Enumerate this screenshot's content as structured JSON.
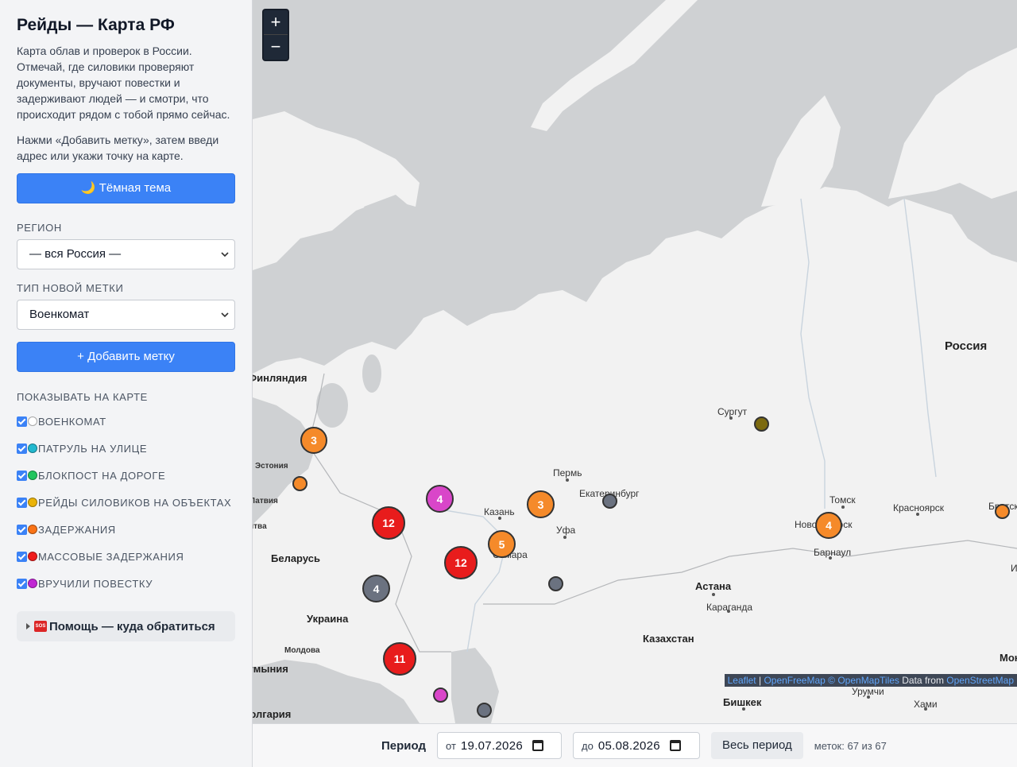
{
  "sidebar": {
    "title": "Рейды — Карта РФ",
    "intro": "Карта облав и проверок в России. Отмечай, где силовики проверяют документы, вручают повестки и задерживают людей — и смотри, что происходит рядом с тобой прямо сейчас.",
    "hint": "Нажми «Добавить метку», затем введи адрес или укажи точку на карте.",
    "theme_button": "🌙 Тёмная тема",
    "region_label": "РЕГИОН",
    "region_value": "— вся Россия —",
    "type_label": "ТИП НОВОЙ МЕТКИ",
    "type_value": "Военкомат",
    "add_button": "+ Добавить метку",
    "layers_label": "ПОКАЗЫВАТЬ НА КАРТЕ",
    "layers": [
      {
        "label": "ВОЕНКОМАТ",
        "color": "#ffffff",
        "checked": true
      },
      {
        "label": "ПАТРУЛЬ НА УЛИЦЕ",
        "color": "#22b8cf",
        "checked": true
      },
      {
        "label": "БЛОКПОСТ НА ДОРОГЕ",
        "color": "#22c55e",
        "checked": true
      },
      {
        "label": "РЕЙДЫ СИЛОВИКОВ НА ОБЪЕКТАХ",
        "color": "#eab308",
        "checked": true
      },
      {
        "label": "ЗАДЕРЖАНИЯ",
        "color": "#f97316",
        "checked": true
      },
      {
        "label": "МАССОВЫЕ ЗАДЕРЖАНИЯ",
        "color": "#ef1c1c",
        "checked": true
      },
      {
        "label": "ВРУЧИЛИ ПОВЕСТКУ",
        "color": "#c026d3",
        "checked": true
      }
    ],
    "help": "Помощь — куда обратиться"
  },
  "map": {
    "zoom_in": "+",
    "zoom_out": "−",
    "places": {
      "finland": "Финляндия",
      "estonia": "Эстония",
      "latvia": "Латвия",
      "lithuania": "Литва",
      "belarus": "Беларусь",
      "ukraine": "Украина",
      "moldova": "Молдова",
      "romania": "Румыния",
      "bulgaria": "Болгария",
      "russia": "Россия",
      "kazakhstan": "Казахстан",
      "astana": "Астана",
      "karaganda": "Караганда",
      "bishkek": "Бишкек",
      "urumqi": "Урумчи",
      "hami": "Хами",
      "perm": "Пермь",
      "yekaterinburg": "Екатеринбург",
      "kazan": "Казань",
      "ufa": "Уфа",
      "samara": "Самара",
      "surgut": "Сургут",
      "tomsk": "Томск",
      "novosibirsk": "Новосибирск",
      "barnaul": "Барнаул",
      "krasnoyarsk": "Красноярск",
      "bratsk": "Братск",
      "irkutsk": "И",
      "mongolia": "Мон"
    },
    "clusters": [
      {
        "id": "c-spb",
        "count": "3",
        "color": "#f58a2a"
      },
      {
        "id": "c-center",
        "count": "4",
        "color": "#d946c9"
      },
      {
        "id": "c-perm",
        "count": "3",
        "color": "#f58a2a"
      },
      {
        "id": "c-moscow",
        "count": "12",
        "color": "#e81c1c"
      },
      {
        "id": "c-samara",
        "count": "5",
        "color": "#f58a2a"
      },
      {
        "id": "c-volga",
        "count": "12",
        "color": "#e81c1c"
      },
      {
        "id": "c-southwest",
        "count": "4",
        "color": "#6b7280"
      },
      {
        "id": "c-south",
        "count": "11",
        "color": "#e81c1c"
      },
      {
        "id": "c-novosib",
        "count": "4",
        "color": "#f58a2a"
      }
    ],
    "attribution": {
      "leaflet": "Leaflet",
      "sep": " | ",
      "omf": "OpenFreeMap",
      "omt": "© OpenMapTiles",
      "data": " Data from ",
      "osm": "OpenStreetMap"
    }
  },
  "bottom": {
    "period_label": "Период",
    "from_prefix": "от",
    "from_value": "19.07.2026",
    "to_prefix": "до",
    "to_value": "05.08.2026",
    "all_button": "Весь период",
    "count_text": "меток: 67 из 67"
  }
}
